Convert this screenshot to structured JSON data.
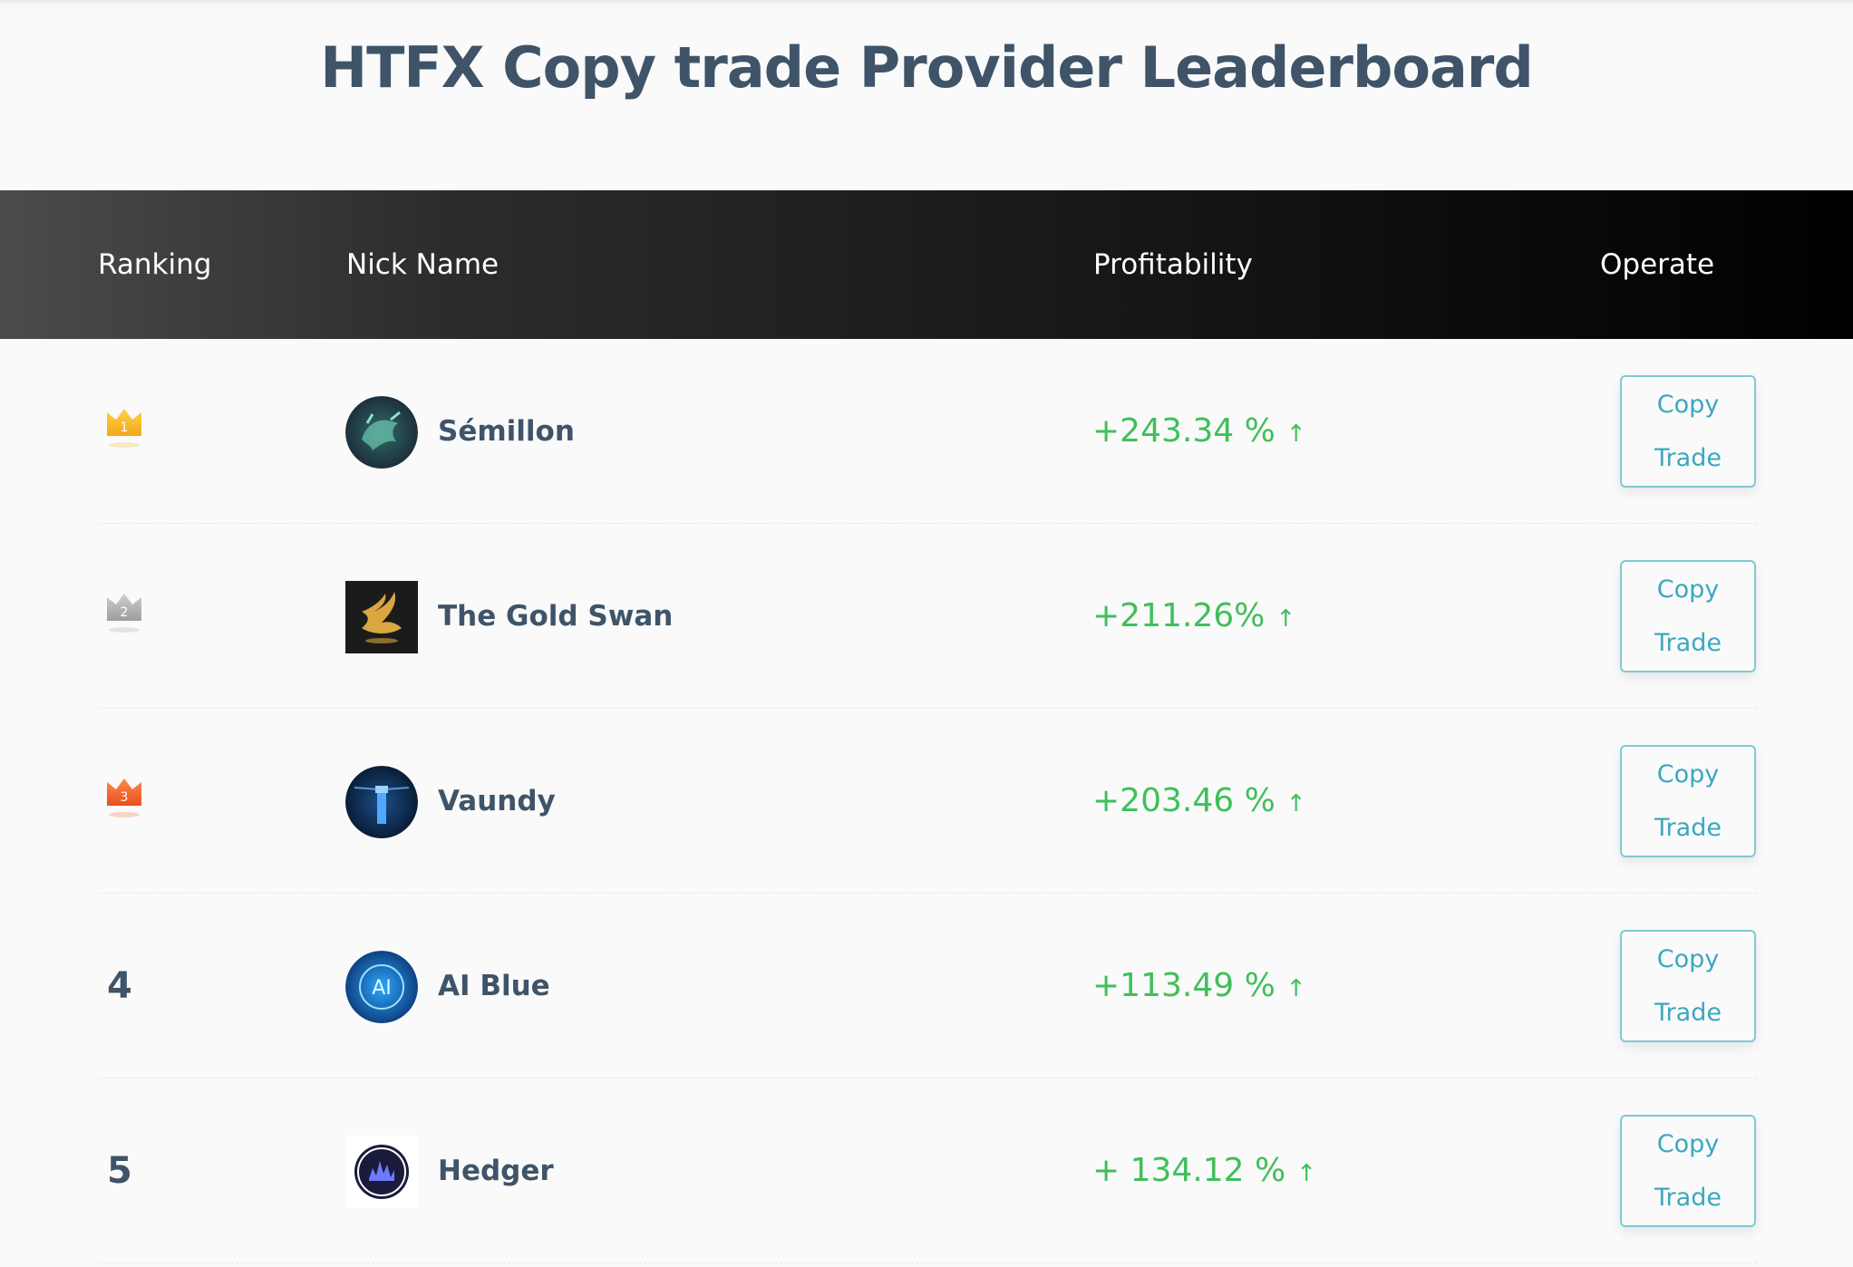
{
  "page": {
    "title": "HTFX Copy trade Provider Leaderboard"
  },
  "table": {
    "headers": {
      "ranking": "Ranking",
      "nick_name": "Nick Name",
      "profitability": "Profitability",
      "operate": "Operate"
    },
    "rows": [
      {
        "rank": "1",
        "rank_style": "gold-crown",
        "avatar": "bull-avatar",
        "name": "Sémillon",
        "profit": "+243.34 %",
        "arrow": "↑",
        "copy": "Copy",
        "trade": "Trade"
      },
      {
        "rank": "2",
        "rank_style": "silver-crown",
        "avatar": "gold-swan-avatar",
        "name": "The Gold Swan",
        "profit": "+211.26%",
        "arrow": "↑",
        "copy": "Copy",
        "trade": "Trade"
      },
      {
        "rank": "3",
        "rank_style": "bronze-crown",
        "avatar": "lighthouse-avatar",
        "name": "Vaundy",
        "profit": "+203.46 %",
        "arrow": "↑",
        "copy": "Copy",
        "trade": "Trade"
      },
      {
        "rank": "4",
        "rank_style": "number",
        "avatar": "ai-avatar",
        "name": "AI Blue",
        "profit": "+113.49 %",
        "arrow": "↑",
        "copy": "Copy",
        "trade": "Trade"
      },
      {
        "rank": "5",
        "rank_style": "number",
        "avatar": "hedger-avatar",
        "name": "Hedger",
        "profit": "+ 134.12 %",
        "arrow": "↑",
        "copy": "Copy",
        "trade": "Trade"
      }
    ]
  },
  "colors": {
    "title": "#3f5468",
    "profit_green": "#3fbf5a",
    "button_teal": "#3aa8bf",
    "crown_gold": "#f5b820",
    "crown_silver": "#b4b4b4",
    "crown_bronze": "#f0642a"
  },
  "text_ai": "AI"
}
